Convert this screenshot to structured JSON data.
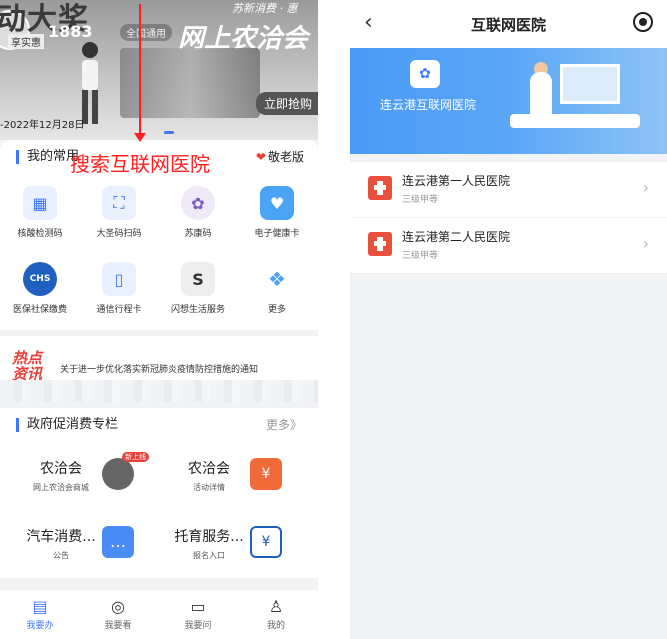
{
  "left": {
    "banner": {
      "big_text": "动大奖",
      "number": "1883",
      "sub_text": "享实惠",
      "pill": "全国通用",
      "slogan": "苏新消费 · 惠",
      "title": "网上农洽会",
      "button": "立即抢购",
      "date": "-2022年12月28日"
    },
    "common": {
      "title": "我的常用",
      "elder_mode": "敬老版",
      "annotation": "搜索互联网医院"
    },
    "grid": [
      {
        "label": "核酸检测码",
        "icon": "qr-code-icon",
        "color": "#3e78ff"
      },
      {
        "label": "大圣码扫码",
        "icon": "scan-icon",
        "color": "#3e78ff"
      },
      {
        "label": "苏康码",
        "icon": "sukang-code-icon",
        "color": "#7a5cc0"
      },
      {
        "label": "电子健康卡",
        "icon": "health-card-icon",
        "color": "#4aa3f5"
      },
      {
        "label": "医保社保缴费",
        "icon": "chs-icon",
        "color": "#1f5fbf"
      },
      {
        "label": "通信行程卡",
        "icon": "trip-card-icon",
        "color": "#3e78ff"
      },
      {
        "label": "闪想生活服务",
        "icon": "life-service-icon",
        "color": "#333333"
      },
      {
        "label": "更多",
        "icon": "more-icon",
        "color": "#4aa3f5"
      }
    ],
    "hot": {
      "badge_line1": "热点",
      "badge_line2": "资讯",
      "text": "关于进一步优化落实新冠肺炎疫情防控措施的通知"
    },
    "promo": {
      "title": "政府促消费专栏",
      "more": "更多》",
      "items": [
        {
          "title": "农洽会",
          "subtitle": "网上农洽会商城",
          "tag": "新上线",
          "icon": "map-icon",
          "color": "#555555"
        },
        {
          "title": "农洽会",
          "subtitle": "活动详情",
          "icon": "coupon-icon",
          "color": "#f06a3a"
        },
        {
          "title": "汽车消费...",
          "subtitle": "公告",
          "icon": "chat-icon",
          "color": "#4a8cf5"
        },
        {
          "title": "托育服务...",
          "subtitle": "报名入口",
          "icon": "receipt-icon",
          "color": "#1f5fbf"
        }
      ]
    },
    "tabs": [
      {
        "label": "我要办",
        "icon": "document-icon",
        "glyph": "▤"
      },
      {
        "label": "我要看",
        "icon": "search-icon",
        "glyph": "◎"
      },
      {
        "label": "我要问",
        "icon": "message-icon",
        "glyph": "▭"
      },
      {
        "label": "我的",
        "icon": "user-icon",
        "glyph": "♙"
      }
    ]
  },
  "right": {
    "nav": {
      "back": "‹",
      "title": "互联网医院"
    },
    "hero": {
      "name": "连云港互联网医院"
    },
    "hospitals": [
      {
        "name": "连云港第一人民医院",
        "level": "三级甲等"
      },
      {
        "name": "连云港第二人民医院",
        "level": "三级甲等"
      }
    ]
  }
}
